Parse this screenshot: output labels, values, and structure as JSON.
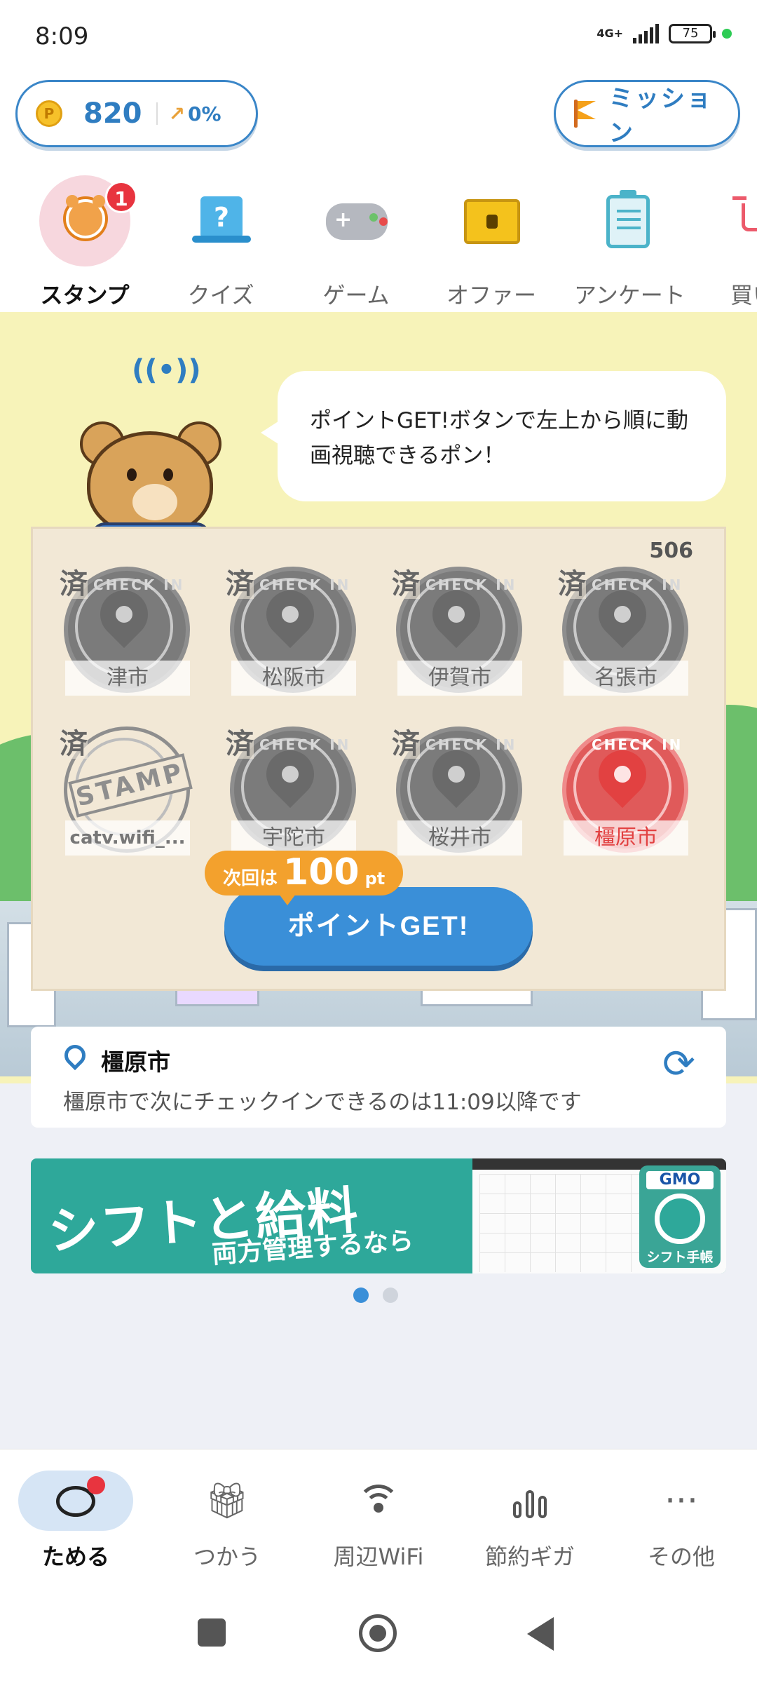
{
  "status_bar": {
    "time": "8:09",
    "network": "4G+",
    "battery": "75"
  },
  "points": {
    "value": "820",
    "trend": "0%",
    "coin_symbol": "P"
  },
  "mission": {
    "label": "ミッション"
  },
  "categories": [
    {
      "label": "スタンプ",
      "badge": "1",
      "icon": "bear-face-icon"
    },
    {
      "label": "クイズ",
      "icon": "quiz-hat-icon",
      "symbol": "?"
    },
    {
      "label": "ゲーム",
      "icon": "gamepad-icon"
    },
    {
      "label": "オファー",
      "icon": "treasure-chest-icon"
    },
    {
      "label": "アンケート",
      "icon": "clipboard-icon"
    },
    {
      "label": "買い",
      "icon": "shopping-cart-icon"
    }
  ],
  "bubble_text": "ポイントGET!ボタンで左上から順に動画視聴できるポン！",
  "stamp_card": {
    "number": "506",
    "done_mark": "済",
    "check_in": "CHECK IN",
    "stamp_word": "STAMP",
    "stamps": [
      {
        "name": "津市",
        "done": true
      },
      {
        "name": "松阪市",
        "done": true
      },
      {
        "name": "伊賀市",
        "done": true
      },
      {
        "name": "名張市",
        "done": true
      },
      {
        "name": "catv.wifi_...",
        "done": true
      },
      {
        "name": "宇陀市",
        "done": true
      },
      {
        "name": "桜井市",
        "done": true
      },
      {
        "name": "橿原市",
        "done": false
      }
    ]
  },
  "next_points": {
    "prefix": "次回は",
    "value": "100",
    "unit": "pt"
  },
  "get_button": "ポイントGET!",
  "location": {
    "name": "橿原市",
    "message": "橿原市で次にチェックインできるのは11:09以降です"
  },
  "banner": {
    "headline": "シフトと給料",
    "sub": "両方管理するなら",
    "brand": "GMO",
    "app_name": "シフト手帳"
  },
  "carousel": {
    "count": 2,
    "active": 0
  },
  "bottom_nav": [
    {
      "label": "ためる",
      "icon": "piggy-bank-icon"
    },
    {
      "label": "つかう",
      "icon": "gift-icon"
    },
    {
      "label": "周辺WiFi",
      "icon": "wifi-icon"
    },
    {
      "label": "節約ギガ",
      "icon": "bar-chart-icon"
    },
    {
      "label": "その他",
      "icon": "more-icon"
    }
  ],
  "colors": {
    "accent": "#3a8fd8",
    "orange": "#f3a12d",
    "badge_red": "#e8343f",
    "card_bg": "#f2e8d6",
    "sky": "#f7f3b9"
  }
}
